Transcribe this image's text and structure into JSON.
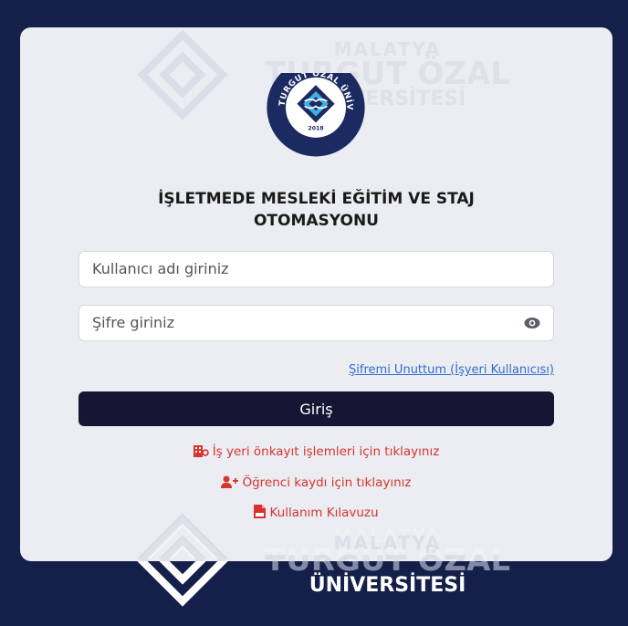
{
  "watermark": {
    "line1": "MALATYA",
    "line2": "TURGUT ÖZAL",
    "line3": "ÜNİVERSİTESİ"
  },
  "logo": {
    "text_arc": "MALATYA TURGUT ÖZAL ÜNİVERSİTESİ",
    "year": "2018"
  },
  "title": {
    "line1": "İŞLETMEDE MESLEKİ EĞİTİM VE STAJ",
    "line2": "OTOMASYONU"
  },
  "form": {
    "username_placeholder": "Kullanıcı adı giriniz",
    "password_placeholder": "Şifre giriniz",
    "forgot_link": "Şifremi Unuttum (İşyeri Kullanıcısı)",
    "login_button": "Giriş"
  },
  "links": {
    "preregistration": "İş yeri önkayıt işlemleri için tıklayınız",
    "student_registration": "Öğrenci kaydı için tıklayınız",
    "user_guide": "Kullanım Kılavuzu"
  },
  "icons": {
    "preregistration": "building-icon",
    "student_registration": "user-plus-icon",
    "user_guide": "pdf-file-icon",
    "password_toggle": "eye-icon"
  },
  "colors": {
    "background": "#14204a",
    "button": "#161533",
    "link_red": "#d8332e",
    "link_blue": "#2f6ecb"
  }
}
